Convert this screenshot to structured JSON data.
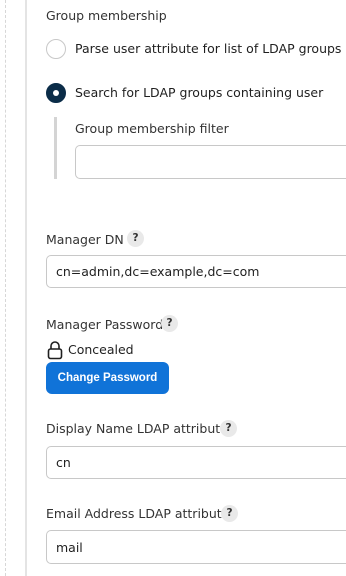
{
  "group_membership": {
    "heading": "Group membership",
    "options": [
      {
        "label": "Parse user attribute for list of LDAP groups",
        "selected": false
      },
      {
        "label": "Search for LDAP groups containing user",
        "selected": true
      }
    ],
    "filter": {
      "label": "Group membership filter",
      "value": ""
    }
  },
  "manager_dn": {
    "label": "Manager DN",
    "help": "?",
    "value": "cn=admin,dc=example,dc=com"
  },
  "manager_password": {
    "label": "Manager Password",
    "help": "?",
    "status": "Concealed",
    "button": "Change Password"
  },
  "display_name": {
    "label": "Display Name LDAP attribute",
    "help": "?",
    "value": "cn"
  },
  "email": {
    "label": "Email Address LDAP attribute",
    "help": "?",
    "value": "mail"
  },
  "colors": {
    "primary_button": "#1073d8",
    "radio_selected": "#0b2c48"
  },
  "icons": {
    "lock": "lock-icon",
    "help": "help-icon"
  }
}
